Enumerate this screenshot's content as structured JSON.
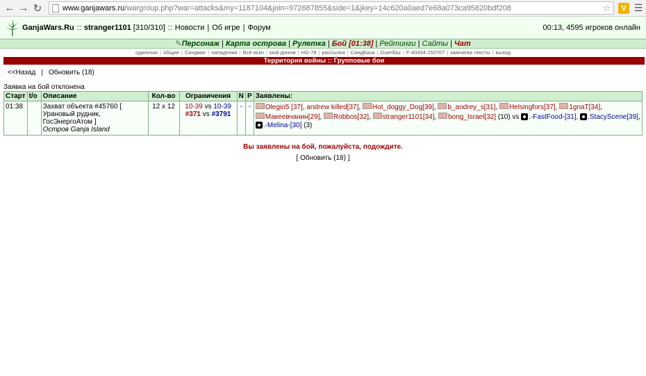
{
  "browser": {
    "url_host": "www.ganjawars.ru",
    "url_path": "/wargroup.php?war=attacks&my=1187104&join=972687855&side=1&jkey=14c620a0aed7e68a073ca95820bdf208",
    "ext_label": "V"
  },
  "header": {
    "site": "GanjaWars.Ru",
    "sep1": "::",
    "user": "stranger1101",
    "hp": "[310/310]",
    "sep2": "::",
    "links": [
      "Новости",
      "Об игре",
      "Форум"
    ],
    "online": "00:13, 4595 игроков онлайн"
  },
  "menu1": [
    "Персонаж",
    "Карта острова",
    "Рулетка",
    "Бой [01:38]",
    "Рейтинги",
    "Сайты",
    "Чат"
  ],
  "menu2": [
    "одиночки",
    "общие",
    "Синдмаг",
    "нападения",
    "Всё искн",
    "мой доннм",
    "HG-78",
    "рассылка",
    "СиндБаза",
    "Guerillaz",
    "F-40434-250707",
    "камчатка тексты",
    "выход"
  ],
  "title_bar": "Территория войны :: Групповые бои",
  "nav": {
    "back": "<<Назад",
    "pipe": "|",
    "refresh": "Обновить (18)"
  },
  "status": "Заявка на бой отклонена",
  "table": {
    "headers": [
      "Старт",
      "t/o",
      "Описание",
      "Кол-во",
      "Ограничения",
      "N",
      "P",
      "Заявлены:"
    ],
    "row": {
      "start": "01:38",
      "to": "",
      "desc1": "Захват объекта #45760 [",
      "desc2": "Урановый рудник,",
      "desc3": "ГосЭнергоАтом ]",
      "desc4": "Остров Ganja Island",
      "count": "12 x 12",
      "lim_a": "10-39",
      "lim_vs": "vs",
      "lim_b": "10-39",
      "syn_a": "#371",
      "syn_b": "#3791",
      "n": "-",
      "p": "-",
      "side1": [
        "Olegio5 [37]",
        "andrew killed[37]",
        "Hot_doggy_Dog[39]",
        "b_andrey_s[31]",
        "Helsingfors[37]",
        "1gnaT[34]",
        "Макеевчанин[29]",
        "Robbos[32]",
        "stranger1101[34]",
        "bong_Israel[32]"
      ],
      "side1_count": "(10)",
      "vs": "vs",
      "side2": [
        ".-FastFood-[31]",
        ".StacyScene[39]",
        ".-Melina-[30]"
      ],
      "side2_count": "(3)"
    }
  },
  "wait_msg": "Вы заявлены на бой, пожалуйста, подождите.",
  "refresh_bottom": "[ Обновить (18) ]"
}
